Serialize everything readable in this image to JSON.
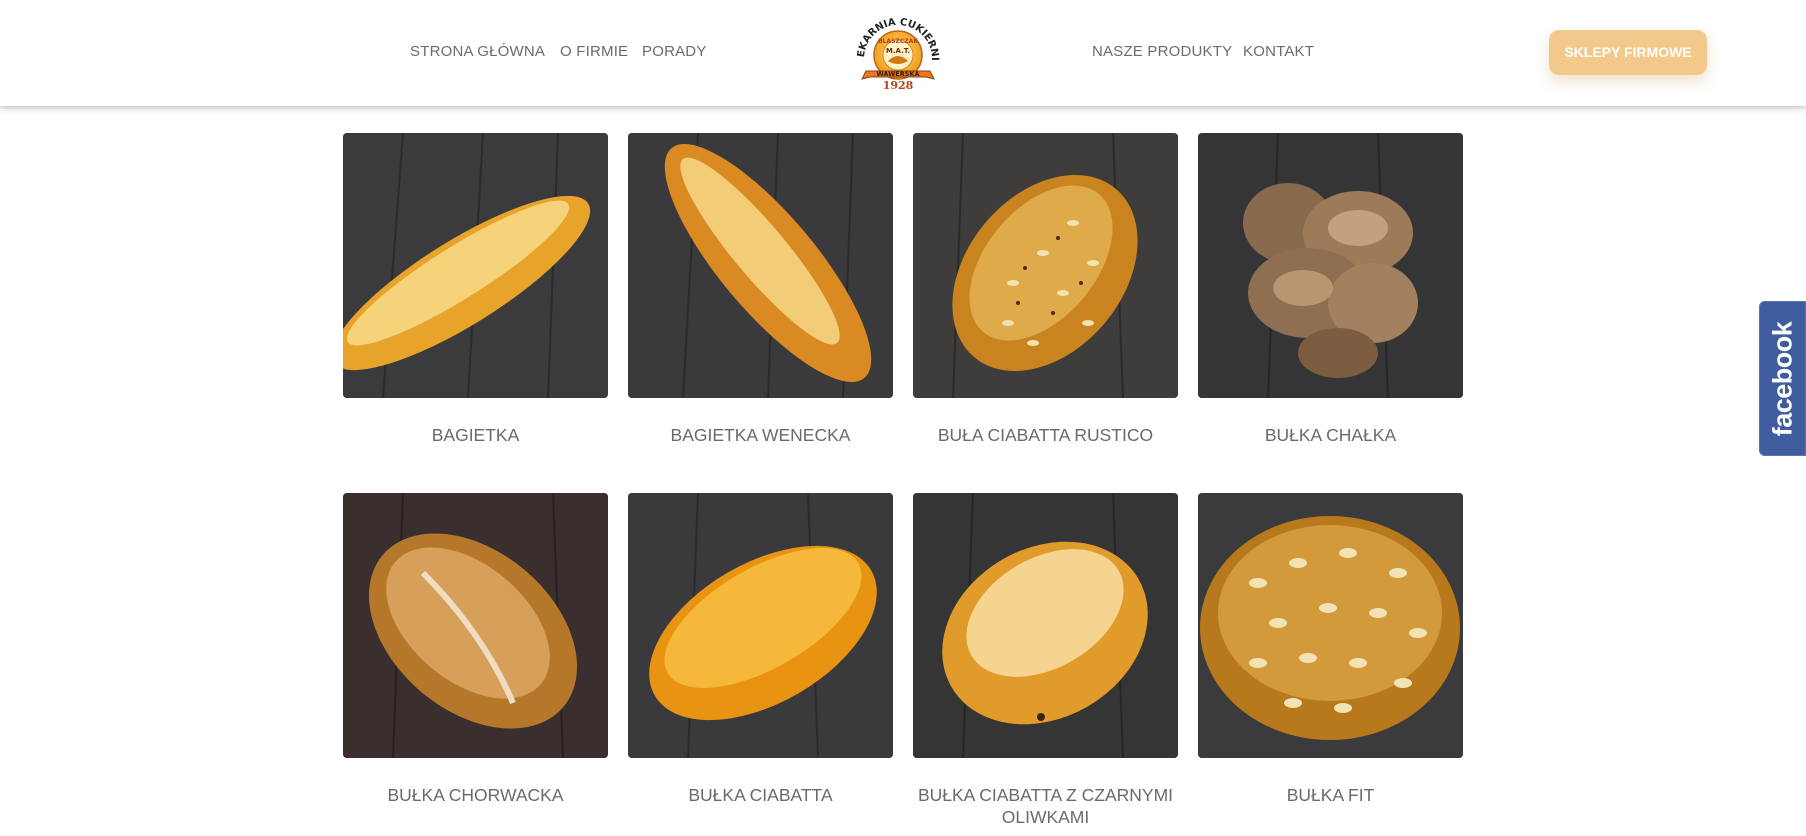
{
  "header": {
    "nav_left": [
      "STRONA GŁÓWNA",
      "O FIRMIE",
      "PORADY"
    ],
    "nav_right": [
      "NASZE PRODUKTY",
      "KONTAKT"
    ],
    "logo": {
      "arc_text": "PIEKARNIA CUKIERNIA",
      "owner": "BLASZCZAK",
      "mark": "M.A.T.",
      "ribbon": "WAWERSKA",
      "year": "1928"
    },
    "cta_label": "SKLEPY FIRMOWE"
  },
  "products": [
    {
      "name": "BAGIETKA"
    },
    {
      "name": "BAGIETKA WENECKA"
    },
    {
      "name": "BUŁA CIABATTA RUSTICO"
    },
    {
      "name": "BUŁKA CHAŁKA"
    },
    {
      "name": "BUŁKA CHORWACKA"
    },
    {
      "name": "BUŁKA CIABATTA"
    },
    {
      "name": "BUŁKA CIABATTA Z CZARNYMI OLIWKAMI"
    },
    {
      "name": "BUŁKA FIT"
    }
  ],
  "facebook_tab": "facebook",
  "colors": {
    "accent": "#f2c98a",
    "facebook": "#3e5c9e",
    "nav_text": "#6b6b6b",
    "photo_background": "#3a3a3c"
  }
}
